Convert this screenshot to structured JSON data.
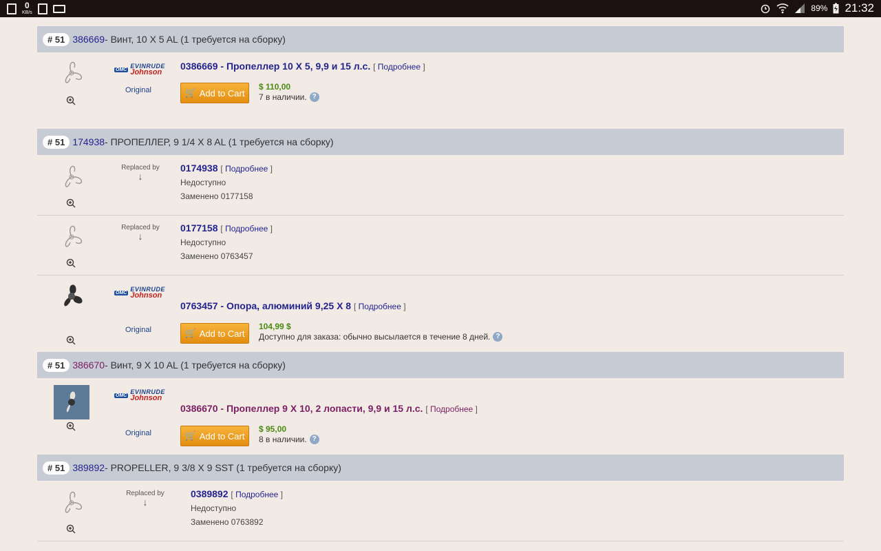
{
  "status_bar": {
    "kb_value": "0",
    "kb_unit": "KB/s",
    "battery": "89%",
    "time": "21:32"
  },
  "labels": {
    "add_to_cart": "Add to Cart",
    "original": "Original",
    "replaced_by": "Replaced by",
    "more": "Подробнее",
    "help": "?",
    "brand_top": "EVINRUDE",
    "brand_bottom": "Johnson",
    "brand_omc": "OMC"
  },
  "groups": [
    {
      "badge": "# 51",
      "number": "386669",
      "description": " - Винт, 10 X 5 AL (1 требуется на сборку)",
      "items": [
        {
          "title": "0386669 - Пропеллер 10 X 5, 9,9 и 15 л.с.",
          "price": "$ 110,00",
          "stock": "7 в наличии."
        }
      ]
    },
    {
      "badge": "# 51",
      "number": "174938",
      "description": " - ПРОПЕЛЛЕР, 9 1/4 X 8 AL (1 требуется на сборку)",
      "items": [
        {
          "title": "0174938",
          "unavailable": "Недоступно",
          "replaced_note": "Заменено 0177158"
        },
        {
          "title": "0177158",
          "unavailable": "Недоступно",
          "replaced_note": "Заменено 0763457"
        },
        {
          "title": "0763457 - Опора, алюминий 9,25 X 8",
          "price": "104,99 $",
          "stock": "Доступно для заказа: обычно высылается в течение 8 дней."
        }
      ]
    },
    {
      "badge": "# 51",
      "number": "386670",
      "description": " - Винт, 9 X 10 AL (1 требуется на сборку)",
      "items": [
        {
          "title": "0386670 - Пропеллер 9 X 10, 2 лопасти, 9,9 и 15 л.с.",
          "price": "$ 95,00",
          "stock": "8 в наличии."
        }
      ]
    },
    {
      "badge": "# 51",
      "number": "389892",
      "description": " - PROPELLER, 9 3/8 X 9 SST (1 требуется на сборку)",
      "items": [
        {
          "title": "0389892",
          "unavailable": "Недоступно",
          "replaced_note": "Заменено 0763892"
        }
      ]
    }
  ]
}
